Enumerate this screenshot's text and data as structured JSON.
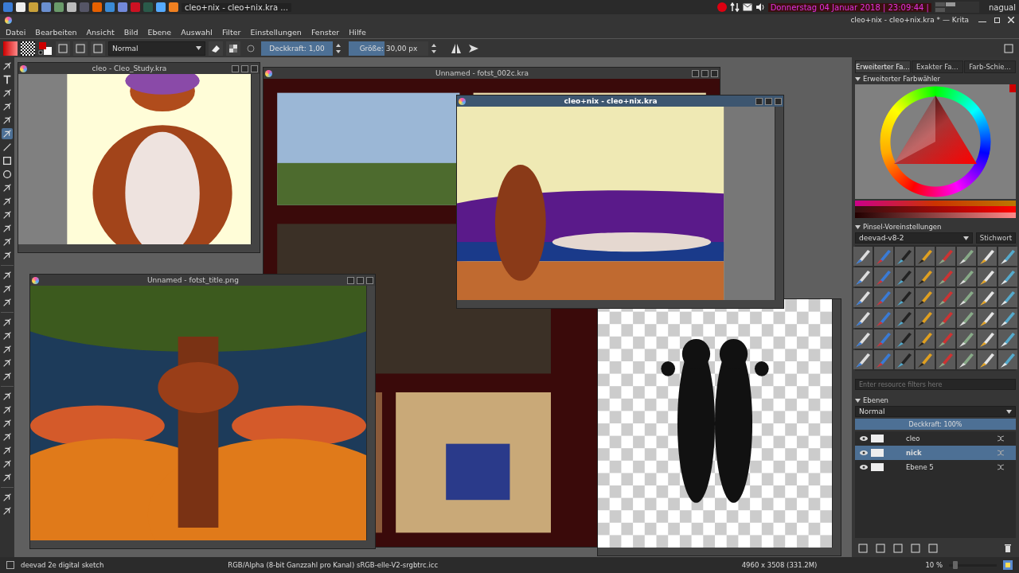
{
  "taskbar": {
    "task": "cleo+nix - cleo+nix.kra ...",
    "clock": "Donnerstag 04 Januar 2018 | 23:09:44 |",
    "user": "nagual"
  },
  "window": {
    "title": "cleo+nix - cleo+nix.kra * — Krita"
  },
  "menu": [
    "Datei",
    "Bearbeiten",
    "Ansicht",
    "Bild",
    "Ebene",
    "Auswahl",
    "Filter",
    "Einstellungen",
    "Fenster",
    "Hilfe"
  ],
  "toolbar": {
    "blend_mode": "Normal",
    "opacity": {
      "text": "Deckkraft:  1,00",
      "level": 1
    },
    "size": {
      "text": "Größe:  30,00 px",
      "level": 0.45
    }
  },
  "subwindows": [
    {
      "title": "Unnamed - fotst_002c.kra",
      "active": false,
      "kind": "collage"
    },
    {
      "kind": "checker"
    },
    {
      "title": "cleo - Cleo_Study.kra",
      "active": false,
      "kind": "portrait"
    },
    {
      "title": "Unnamed - fotst_title.png",
      "active": false,
      "kind": "forest"
    },
    {
      "title": "cleo+nix - cleo+nix.kra",
      "active": true,
      "kind": "room"
    }
  ],
  "color_docker": {
    "tabs": [
      {
        "label": "Erweiterter Fa...",
        "selected": true
      },
      {
        "label": "Exakter Fa...",
        "selected": false
      },
      {
        "label": "Farb-Schie...",
        "selected": false
      }
    ],
    "title": "Erweiterter Farbwähler"
  },
  "brush_docker": {
    "title": "Pinsel-Voreinstellungen",
    "preset": "deevad-v8-2",
    "tag": "Stichwort",
    "filter_placeholder": "Enter resource filters here"
  },
  "layers_docker": {
    "title": "Ebenen",
    "blend_mode": "Normal",
    "opacity": {
      "text": "Deckkraft:  100%",
      "level": 1
    },
    "layers": [
      {
        "name": "cleo",
        "selected": false,
        "visible": true
      },
      {
        "name": "nick",
        "selected": true,
        "visible": true
      },
      {
        "name": "Ebene 5",
        "selected": false,
        "visible": true
      }
    ]
  },
  "status_bar": {
    "brush": "deevad 2e digital sketch",
    "color_space": "RGB/Alpha (8-bit Ganzzahl pro Kanal)  sRGB-elle-V2-srgbtrc.icc",
    "size": "4960 x 3508 (331.2M)",
    "zoom": {
      "text": "10 %",
      "level": 0.08
    }
  }
}
